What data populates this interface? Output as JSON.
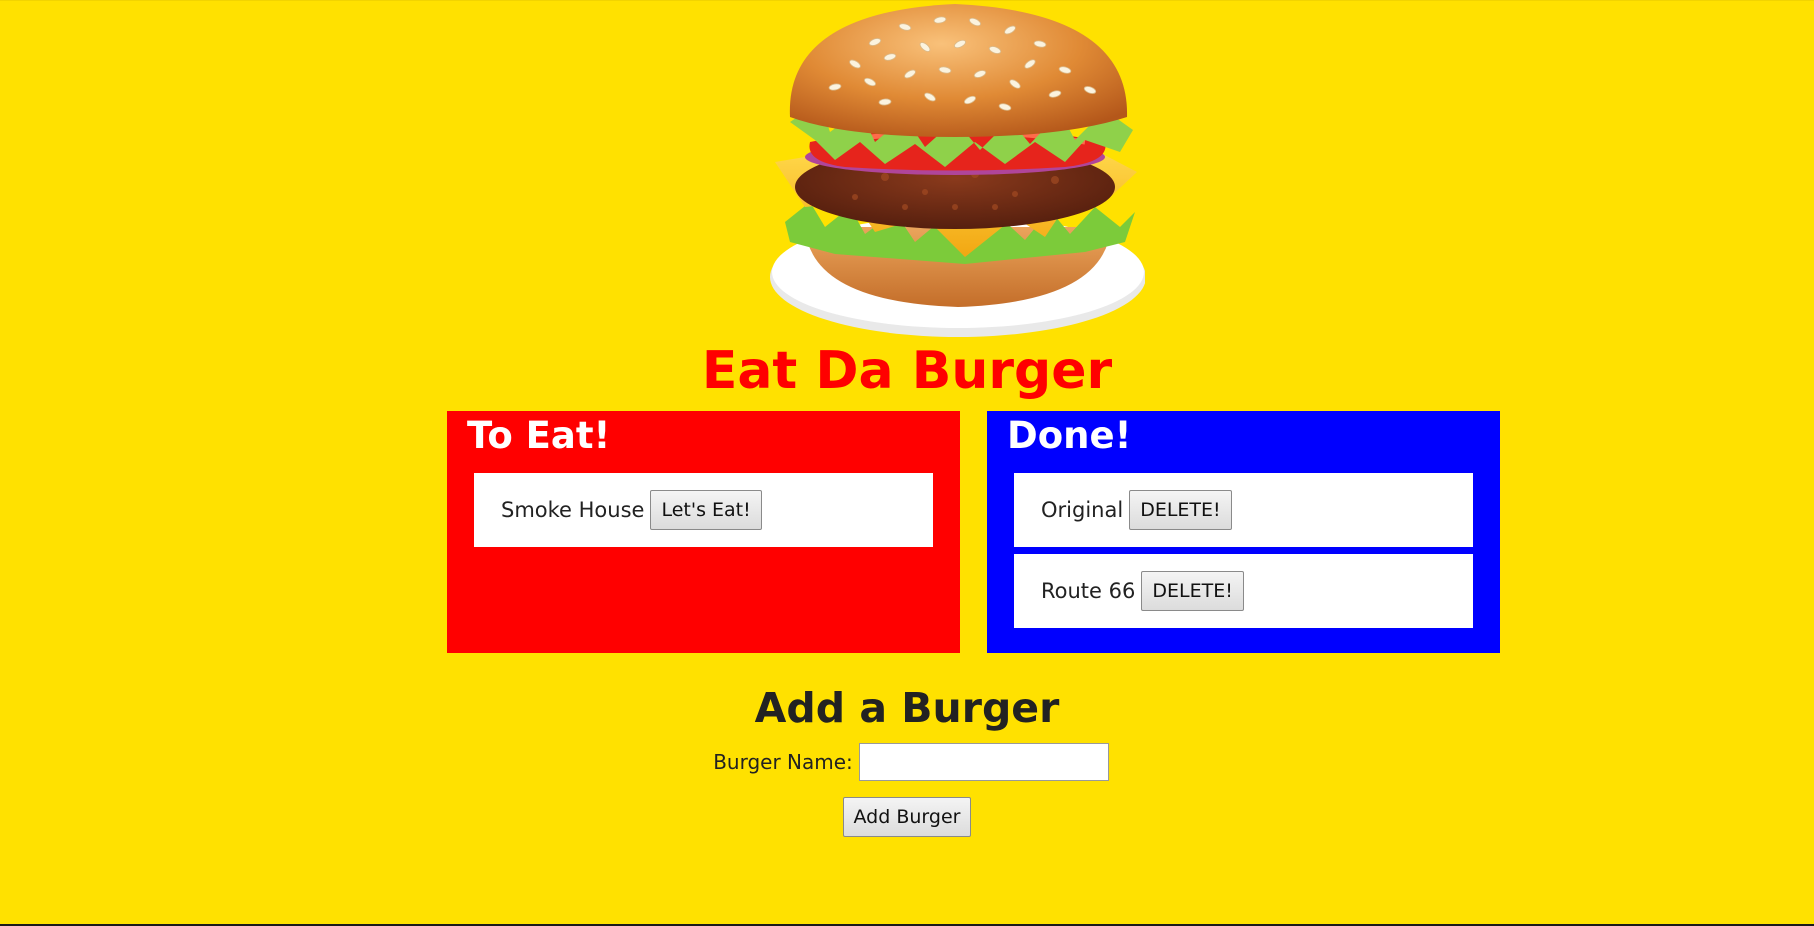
{
  "app": {
    "title": "Eat Da Burger"
  },
  "colors": {
    "background": "#ffe100",
    "title": "#ff0000",
    "to_eat_panel": "#ff0000",
    "done_panel": "#0000ff"
  },
  "to_eat": {
    "heading": "To Eat!",
    "items": [
      {
        "name": "Smoke House",
        "action_label": "Let's Eat!"
      }
    ]
  },
  "done": {
    "heading": "Done!",
    "items": [
      {
        "name": "Original",
        "action_label": "DELETE!"
      },
      {
        "name": "Route 66",
        "action_label": "DELETE!"
      }
    ]
  },
  "add_form": {
    "heading": "Add a Burger",
    "name_label": "Burger Name:",
    "name_value": "",
    "name_placeholder": "",
    "submit_label": "Add Burger"
  }
}
